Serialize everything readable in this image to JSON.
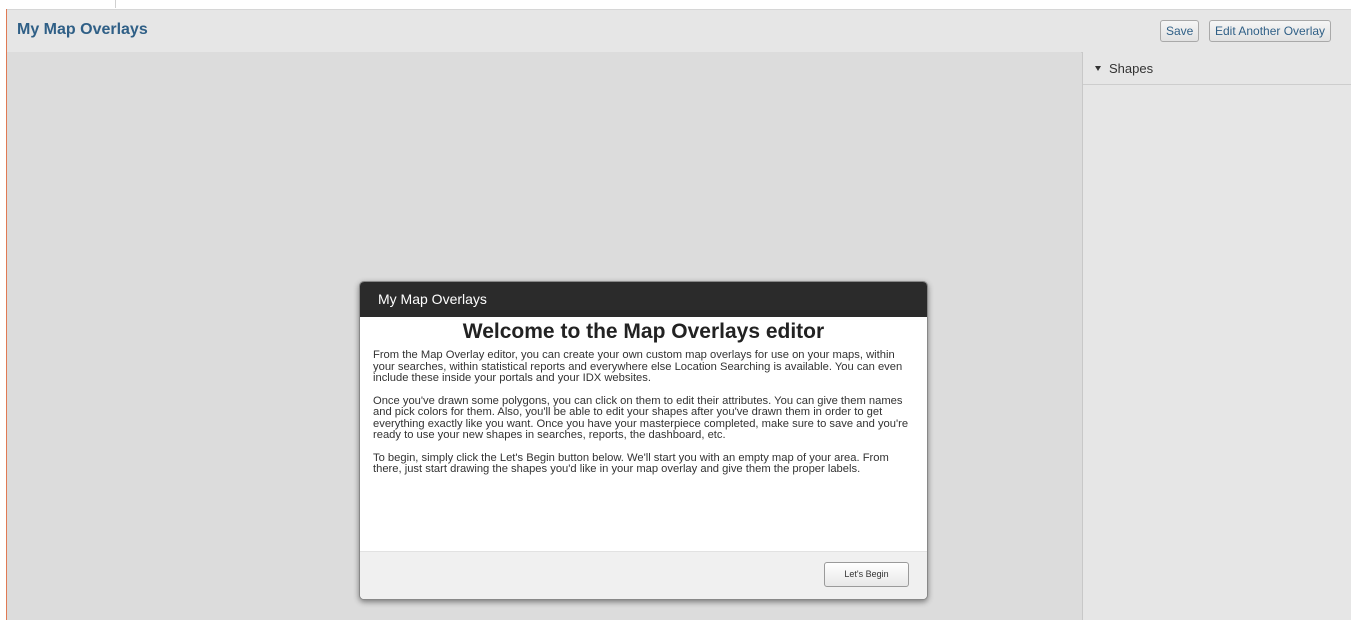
{
  "header": {
    "title": "My Map Overlays",
    "save_label": "Save",
    "edit_another_label": "Edit Another Overlay"
  },
  "side_panel": {
    "section_label": "Shapes",
    "section_icon": "triangle-down-icon"
  },
  "dialog": {
    "title": "My Map Overlays",
    "heading": "Welcome to the Map Overlays editor",
    "paragraphs": [
      "From the Map Overlay editor, you can create your own custom map overlays for use on your maps, within your searches, within statistical reports and everywhere else Location Searching is available. You can even include these inside your portals and your IDX websites.",
      "Once you've drawn some polygons, you can click on them to edit their attributes. You can give them names and pick colors for them. Also, you'll be able to edit your shapes after you've drawn them in order to get everything exactly like you want. Once you have your masterpiece completed, make sure to save and you're ready to use your new shapes in searches, reports, the dashboard, etc.",
      "To begin, simply click the Let's Begin button below. We'll start you with an empty map of your area. From there, just start drawing the shapes you'd like in your map overlay and give them the proper labels."
    ],
    "begin_label": "Let's Begin"
  },
  "colors": {
    "title_blue": "#2f5f86",
    "dialog_titlebar": "#2b2b2b",
    "map_background": "#dcdcdc",
    "panel_background": "#e6e6e6"
  }
}
